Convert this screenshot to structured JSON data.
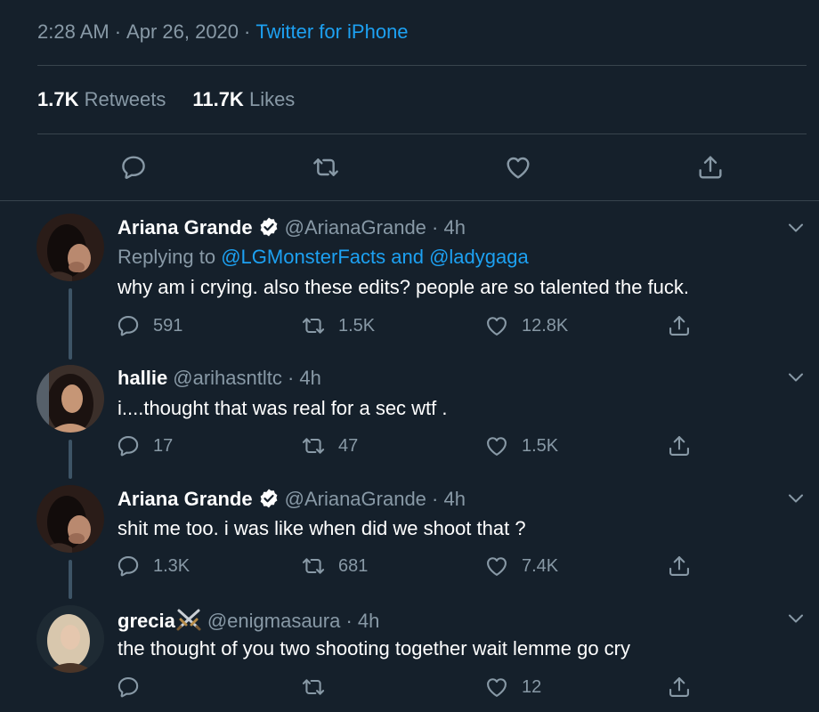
{
  "tweet_meta": {
    "time": "2:28 AM",
    "date": "Apr 26, 2020",
    "source": "Twitter for iPhone"
  },
  "stats": {
    "retweets_count": "1.7K",
    "retweets_label": "Retweets",
    "likes_count": "11.7K",
    "likes_label": "Likes"
  },
  "replies": [
    {
      "name": "Ariana Grande",
      "handle": "@ArianaGrande",
      "time": "· 4h",
      "replying_prefix": "Replying to",
      "replying_to": "@LGMonsterFacts and @ladygaga",
      "text": "why am i crying. also these edits? people are so talented the fuck.",
      "reply_count": "591",
      "retweet_count": "1.5K",
      "like_count": "12.8K"
    },
    {
      "name": "hallie",
      "handle": "@arihasntltc",
      "time": "· 4h",
      "text": "i....thought that was real for a sec wtf .",
      "reply_count": "17",
      "retweet_count": "47",
      "like_count": "1.5K"
    },
    {
      "name": "Ariana Grande",
      "handle": "@ArianaGrande",
      "time": "· 4h",
      "text": "shit me too. i was like when did we shoot that ?",
      "reply_count": "1.3K",
      "retweet_count": "681",
      "like_count": "7.4K"
    },
    {
      "name": "grecia",
      "handle": "@enigmasaura",
      "time": "· 4h",
      "text": "the thought of you two shooting together wait lemme go cry",
      "reply_count": "",
      "retweet_count": "",
      "like_count": "12"
    }
  ],
  "colors": {
    "background": "#15202b",
    "accent": "#1da1f2",
    "muted": "#8899a6",
    "divider": "#38444d"
  },
  "icons": [
    "reply-icon",
    "retweet-icon",
    "like-icon",
    "share-icon",
    "verified-badge-icon",
    "chevron-down-icon",
    "crossed-swords-icon"
  ]
}
